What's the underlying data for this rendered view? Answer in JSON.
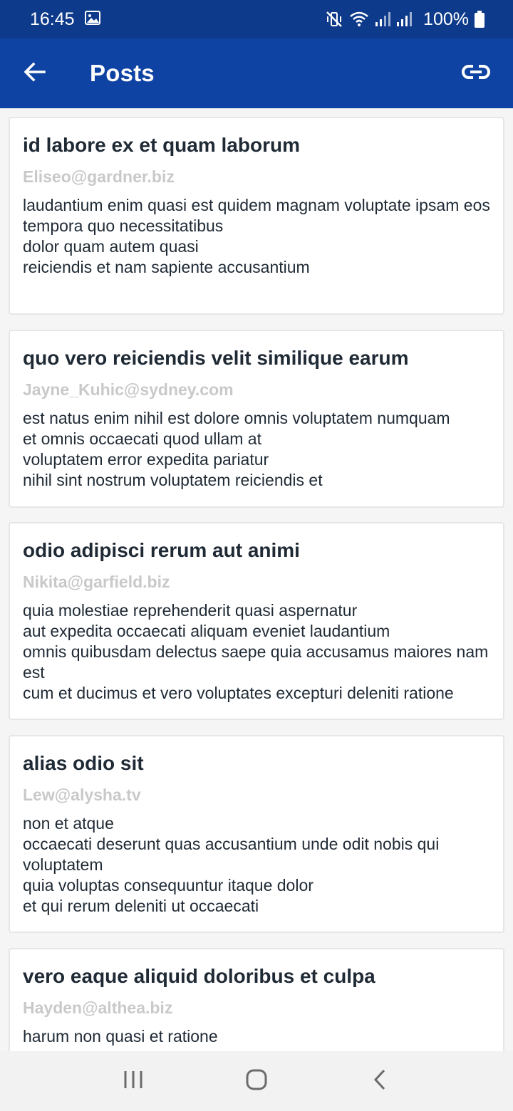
{
  "status_bar": {
    "time": "16:45",
    "battery_percent": "100%",
    "icons": [
      "image-icon",
      "mute-vibrate-icon",
      "wifi-icon",
      "signal-icon",
      "signal-icon",
      "battery-icon"
    ]
  },
  "app_bar": {
    "title": "Posts",
    "back_icon": "arrow-back-icon",
    "action_icon": "link-icon",
    "color": "#0f43a3"
  },
  "posts": [
    {
      "title": "id labore ex et quam laborum",
      "email": "Eliseo@gardner.biz",
      "body": "laudantium enim quasi est quidem magnam voluptate ipsam eos\ntempora quo necessitatibus\ndolor quam autem quasi\nreiciendis et nam sapiente accusantium"
    },
    {
      "title": "quo vero reiciendis velit similique earum",
      "email": "Jayne_Kuhic@sydney.com",
      "body": "est natus enim nihil est dolore omnis voluptatem numquam\net omnis occaecati quod ullam at\nvoluptatem error expedita pariatur\nnihil sint nostrum voluptatem reiciendis et"
    },
    {
      "title": "odio adipisci rerum aut animi",
      "email": "Nikita@garfield.biz",
      "body": "quia molestiae reprehenderit quasi aspernatur\naut expedita occaecati aliquam eveniet laudantium\nomnis quibusdam delectus saepe quia accusamus maiores nam est\ncum et ducimus et vero voluptates excepturi deleniti ratione"
    },
    {
      "title": "alias odio sit",
      "email": "Lew@alysha.tv",
      "body": "non et atque\noccaecati deserunt quas accusantium unde odit nobis qui voluptatem\nquia voluptas consequuntur itaque dolor\net qui rerum deleniti ut occaecati"
    },
    {
      "title": "vero eaque aliquid doloribus et culpa",
      "email": "Hayden@althea.biz",
      "body": "harum non quasi et ratione"
    }
  ],
  "nav_bar": {
    "icons": [
      "recent-apps-icon",
      "home-icon",
      "back-icon"
    ]
  }
}
